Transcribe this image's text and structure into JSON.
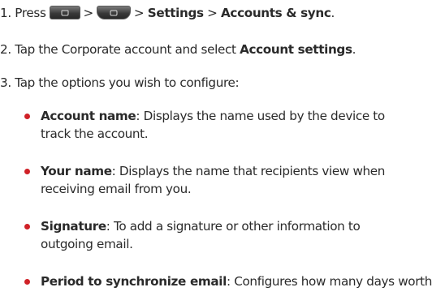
{
  "steps": [
    {
      "number": "1.",
      "t1": "Press",
      "sep1": ">",
      "sep2": ">",
      "bold1": "Settings",
      "sep3": ">",
      "bold2": "Accounts & sync",
      "end": "."
    },
    {
      "number": "2.",
      "t1": "Tap the Corporate account and select",
      "bold1": "Account settings",
      "end": "."
    },
    {
      "number": "3.",
      "t1": "Tap the options you wish to configure:"
    }
  ],
  "options": [
    {
      "term": "Account name",
      "line1": ": Displays the name used by the device to",
      "line2": "track the account."
    },
    {
      "term": "Your name",
      "line1": ": Displays the name that recipients view when",
      "line2": "receiving email from you."
    },
    {
      "term": "Signature",
      "line1": ": To add a signature or other information to",
      "line2": "outgoing email."
    },
    {
      "term": "Period to synchronize email",
      "line1": ": Configures how many days worth"
    }
  ],
  "colors": {
    "bullet": "#d02127",
    "text": "#2a2a2a"
  },
  "icons": [
    "home-key-icon",
    "menu-key-icon"
  ]
}
